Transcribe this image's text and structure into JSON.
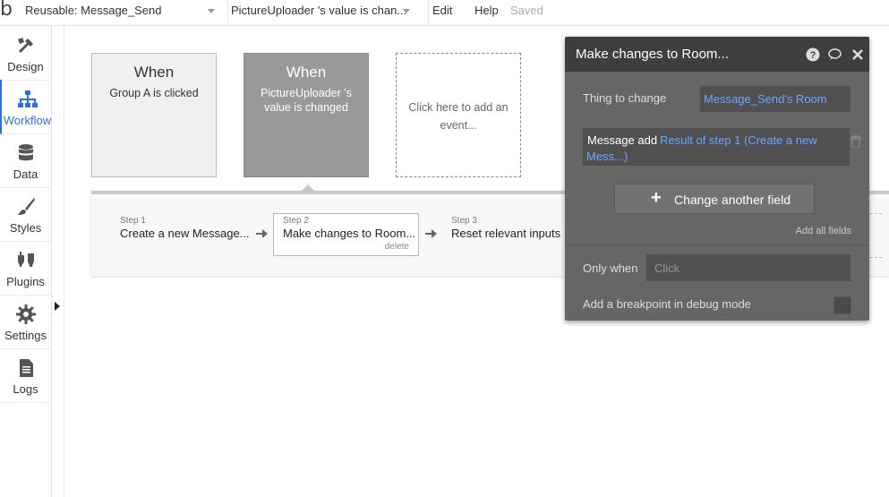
{
  "topbar": {
    "logo": "b",
    "page_dropdown": "Reusable: Message_Send",
    "event_dropdown": "PictureUploader 's value is chan...",
    "menu": [
      "Edit",
      "Help",
      "Saved"
    ]
  },
  "sidebar": {
    "items": [
      {
        "label": "Design",
        "icon": "design-icon"
      },
      {
        "label": "Workflow",
        "icon": "workflow-icon"
      },
      {
        "label": "Data",
        "icon": "data-icon"
      },
      {
        "label": "Styles",
        "icon": "brush-icon"
      },
      {
        "label": "Plugins",
        "icon": "plugin-icon"
      },
      {
        "label": "Settings",
        "icon": "gear-icon"
      },
      {
        "label": "Logs",
        "icon": "document-icon"
      }
    ]
  },
  "events": [
    {
      "when": "When",
      "desc": "Group A is clicked"
    },
    {
      "when": "When",
      "desc": "PictureUploader 's value is changed"
    },
    {
      "desc": "Click here to add an event..."
    }
  ],
  "steps": [
    {
      "num": "Step 1",
      "title": "Create a new Message..."
    },
    {
      "num": "Step 2",
      "title": "Make changes to Room...",
      "delete": "delete"
    },
    {
      "num": "Step 3",
      "title": "Reset relevant inputs"
    }
  ],
  "panel": {
    "title": "Make changes to Room...",
    "thing_label": "Thing to change",
    "thing_value": "Message_Send's Room",
    "field_name": "Message add",
    "field_value": "Result of step 1 (Create a new",
    "field_value_2": "Mess...)",
    "change_button": "Change another field",
    "add_all": "Add all fields",
    "only_when_label": "Only when",
    "only_when_placeholder": "Click",
    "breakpoint_label": "Add a breakpoint in debug mode"
  },
  "colors": {
    "accent": "#2f6fd6",
    "link_blue": "#6aa7ff",
    "panel_bg": "#666666",
    "panel_header": "#3e3e3e"
  }
}
